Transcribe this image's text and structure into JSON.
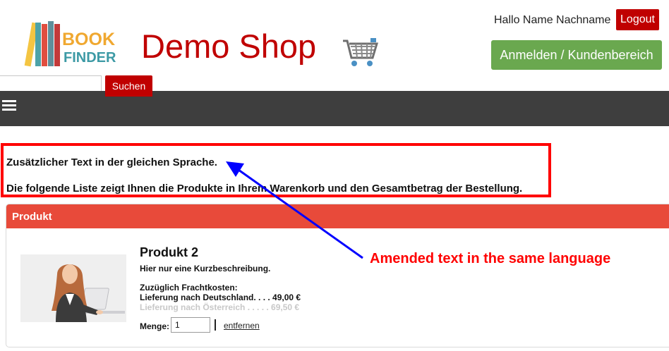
{
  "header": {
    "logo_text_top": "BOOK",
    "logo_text_bottom": "FINDER",
    "shop_title": "Demo Shop",
    "greeting": "Hallo Name Nachname",
    "logout_label": "Logout",
    "login_label": "Anmelden / Kundenbereich",
    "cart_icon": "shopping-cart-icon"
  },
  "search": {
    "value": "",
    "button_label": "Suchen"
  },
  "nav": {
    "menu_icon": "hamburger-menu-icon"
  },
  "info": {
    "line1": "Zusätzlicher Text in der gleichen Sprache.",
    "line2": "Die folgende Liste zeigt Ihnen die Produkte in Ihrem Warenkorb und den Gesamtbetrag der Bestellung."
  },
  "panel": {
    "header_label": "Produkt"
  },
  "product": {
    "name": "Produkt 2",
    "description": "Hier nur eine Kurzbeschreibung.",
    "shipping_title": "Zuzüglich Frachtkosten:",
    "shipping_de": "Lieferung nach Deutschland. . . . 49,00 €",
    "shipping_at": "Lieferung nach Österreich . . . . . 69,50 €",
    "quantity_label": "Menge:",
    "quantity_value": "1",
    "remove_label": "entfernen"
  },
  "annotation": {
    "text": "Amended text in the same language"
  },
  "colors": {
    "brand_red": "#c00000",
    "login_green": "#6aa84f",
    "panel_header": "#e84a3a",
    "nav_dark": "#3e3e3e",
    "annotation_red": "#ff0000",
    "arrow_blue": "#0000ff"
  }
}
